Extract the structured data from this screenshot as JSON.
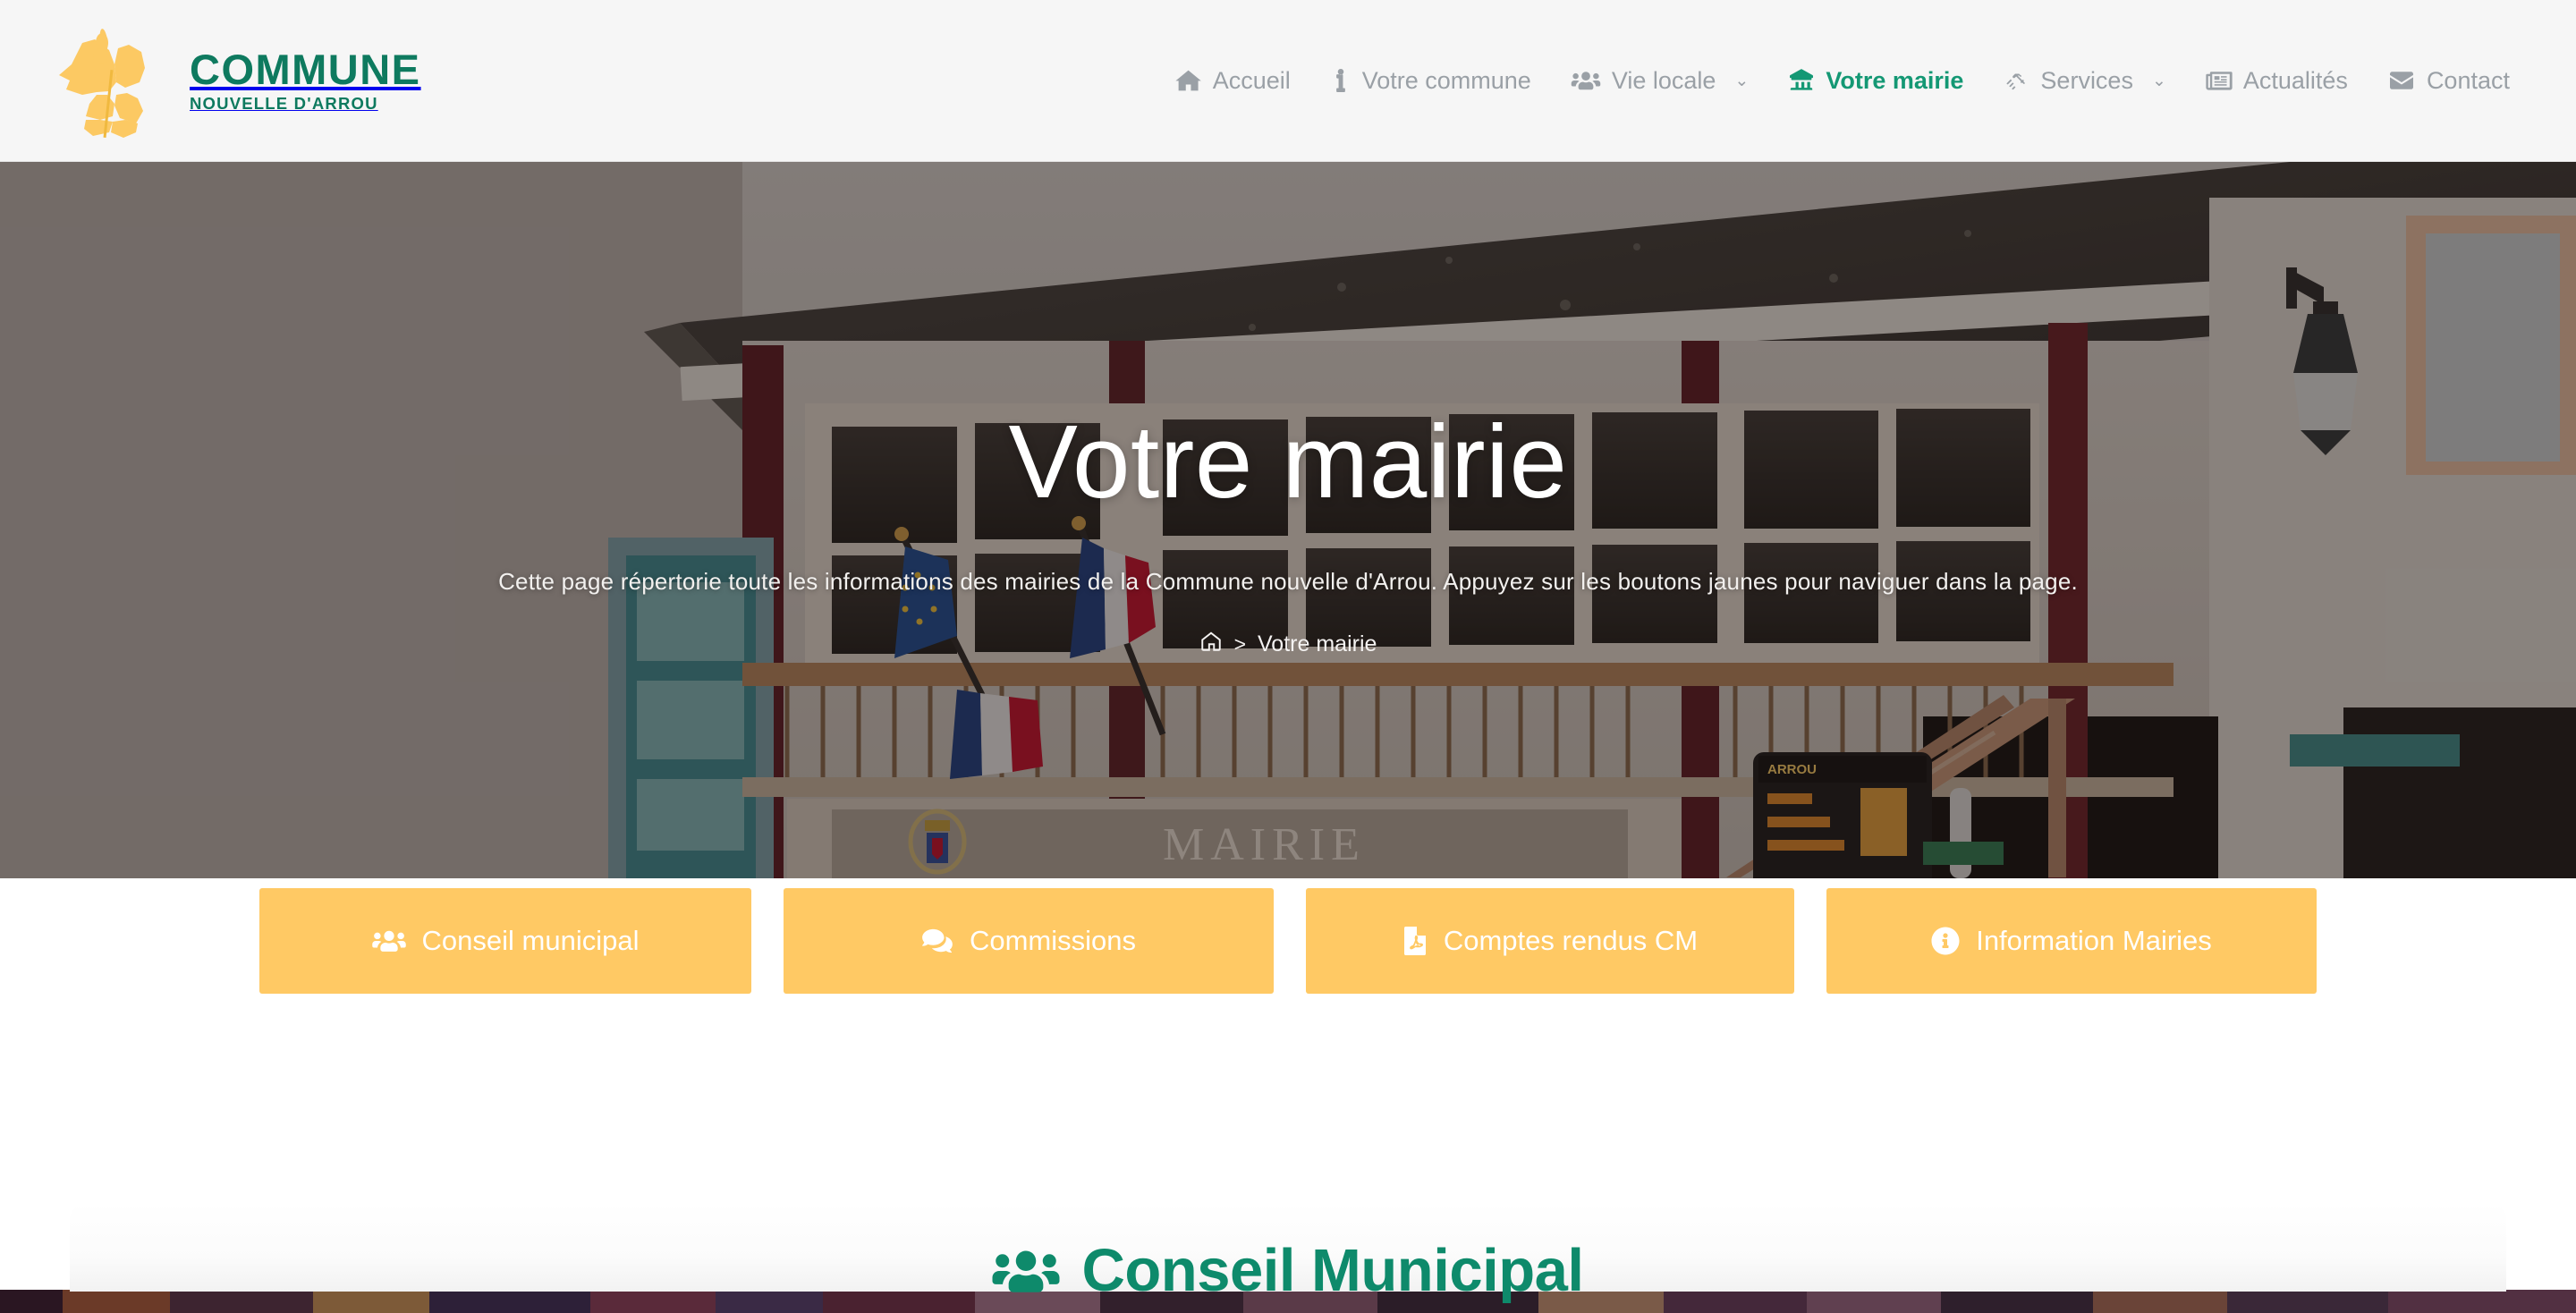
{
  "brand": {
    "logo_icon": "commune-map-wheat-logo",
    "title": "COMMUNE",
    "subtitle": "NOUVELLE D'ARROU"
  },
  "nav": {
    "items": [
      {
        "label": "Accueil",
        "icon": "home-icon",
        "active": false,
        "has_dropdown": false
      },
      {
        "label": "Votre commune",
        "icon": "info-icon",
        "active": false,
        "has_dropdown": false
      },
      {
        "label": "Vie locale",
        "icon": "users-icon",
        "active": false,
        "has_dropdown": true
      },
      {
        "label": "Votre mairie",
        "icon": "landmark-icon",
        "active": true,
        "has_dropdown": false
      },
      {
        "label": "Services",
        "icon": "handshake-icon",
        "active": false,
        "has_dropdown": true
      },
      {
        "label": "Actualités",
        "icon": "news-icon",
        "active": false,
        "has_dropdown": false
      },
      {
        "label": "Contact",
        "icon": "envelope-icon",
        "active": false,
        "has_dropdown": false
      }
    ],
    "caret": "⌄"
  },
  "hero": {
    "title": "Votre mairie",
    "subtitle": "Cette page répertorie toute les informations des mairies de la Commune nouvelle d'Arrou. Appuyez sur les boutons jaunes pour naviguer dans la page.",
    "breadcrumb": {
      "home_icon": "home-icon",
      "separator": ">",
      "current": "Votre mairie"
    },
    "background_alt": "Façade de la mairie d'Arrou avec drapeaux et escalier"
  },
  "quicklinks": [
    {
      "label": "Conseil municipal",
      "icon": "users-icon"
    },
    {
      "label": "Commissions",
      "icon": "comments-icon"
    },
    {
      "label": "Comptes rendus CM",
      "icon": "file-pdf-icon"
    },
    {
      "label": "Information Mairies",
      "icon": "info-circle-icon"
    }
  ],
  "section": {
    "title": "Conseil Municipal",
    "icon": "users-icon"
  },
  "colors": {
    "brand_green": "#0e7a5f",
    "active_green": "#149874",
    "heading_green": "#0e8a6b",
    "button_yellow": "#ffc964",
    "header_bg": "#f6f6f6",
    "nav_grey": "#9aa0a6"
  }
}
